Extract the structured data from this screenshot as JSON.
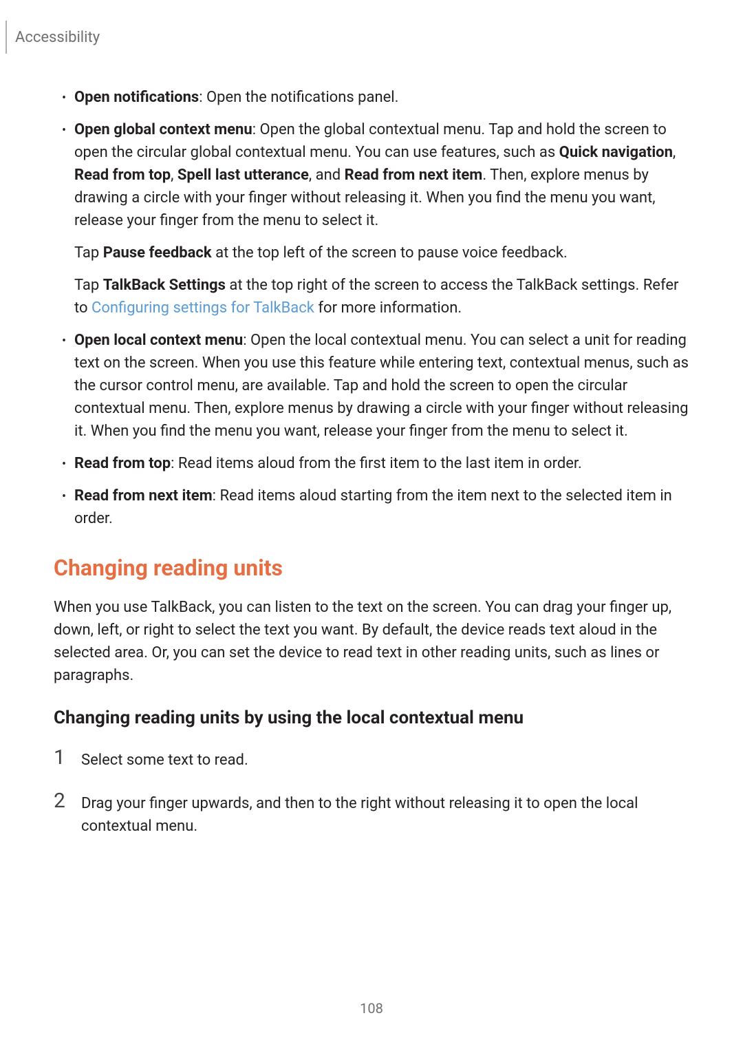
{
  "header": {
    "section": "Accessibility"
  },
  "bullets": [
    {
      "lead": "Open notifications",
      "rest": ": Open the notifications panel."
    },
    {
      "lead": "Open global context menu",
      "rest_1": ": Open the global contextual menu. Tap and hold the screen to open the circular global contextual menu. You can use features, such as ",
      "b1": "Quick navigation",
      "c1": ", ",
      "b2": "Read from top",
      "c2": ", ",
      "b3": "Spell last utterance",
      "c3": ", and ",
      "b4": "Read from next item",
      "rest_2": ". Then, explore menus by drawing a circle with your finger without releasing it. When you find the menu you want, release your finger from the menu to select it."
    }
  ],
  "sub_paras": {
    "p1_pre": "Tap ",
    "p1_b": "Pause feedback",
    "p1_post": " at the top left of the screen to pause voice feedback.",
    "p2_pre": "Tap ",
    "p2_b": "TalkBack Settings",
    "p2_mid": " at the top right of the screen to access the TalkBack settings. Refer to ",
    "p2_link": "Configuring settings for TalkBack",
    "p2_post": " for more information."
  },
  "bullets2": [
    {
      "lead": "Open local context menu",
      "rest": ": Open the local contextual menu. You can select a unit for reading text on the screen. When you use this feature while entering text, contextual menus, such as the cursor control menu, are available. Tap and hold the screen to open the circular contextual menu. Then, explore menus by drawing a circle with your finger without releasing it. When you find the menu you want, release your finger from the menu to select it."
    },
    {
      "lead": "Read from top",
      "rest": ": Read items aloud from the first item to the last item in order."
    },
    {
      "lead": "Read from next item",
      "rest": ": Read items aloud starting from the item next to the selected item in order."
    }
  ],
  "section_heading": "Changing reading units",
  "body_para": "When you use TalkBack, you can listen to the text on the screen. You can drag your finger up, down, left, or right to select the text you want. By default, the device reads text aloud in the selected area. Or, you can set the device to read text in other reading units, such as lines or paragraphs.",
  "sub_heading": "Changing reading units by using the local contextual menu",
  "steps": [
    {
      "n": "1",
      "t": "Select some text to read."
    },
    {
      "n": "2",
      "t": "Drag your finger upwards, and then to the right without releasing it to open the local contextual menu."
    }
  ],
  "page_number": "108",
  "bullet_glyph": "•"
}
